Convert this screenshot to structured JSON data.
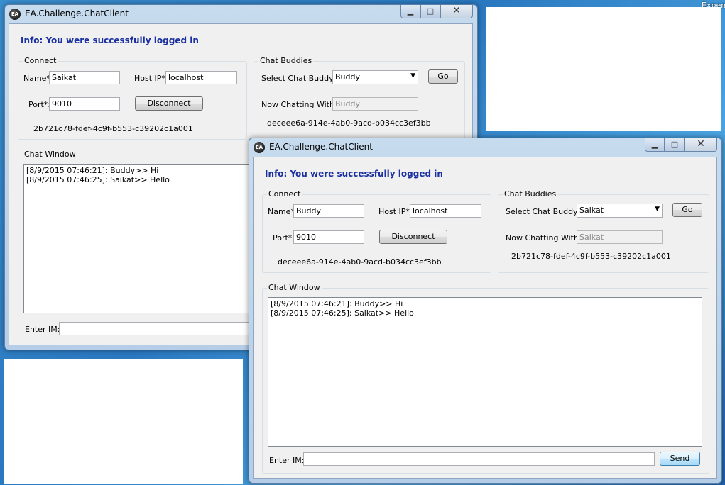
{
  "desktop": {
    "top_right_text": "Expens"
  },
  "window_back": {
    "title": "EA.Challenge.ChatClient",
    "controls": {
      "minimize": "▁",
      "maximize": "□",
      "close": "✕"
    },
    "info": "Info: You were successfully logged in",
    "connect": {
      "group_title": "Connect",
      "name_label": "Name*:",
      "name_value": "Saikat",
      "host_label": "Host IP*:",
      "host_value": "localhost",
      "port_label": "Port*:",
      "port_value": "9010",
      "disconnect_label": "Disconnect",
      "guid": "2b721c78-fdef-4c9f-b553-c39202c1a001"
    },
    "buddies": {
      "group_title": "Chat Buddies",
      "select_label": "Select Chat Buddy:",
      "select_value": "Buddy",
      "go_label": "Go",
      "now_chatting_label": "Now Chatting With:",
      "now_chatting_value": "Buddy",
      "guid": "deceee6a-914e-4ab0-9acd-b034cc3ef3bb"
    },
    "chat": {
      "group_title": "Chat Window",
      "lines": [
        "[8/9/2015 07:46:21]: Buddy>> Hi",
        "[8/9/2015 07:46:25]: Saikat>> Hello"
      ],
      "enter_label": "Enter IM:"
    }
  },
  "window_front": {
    "title": "EA.Challenge.ChatClient",
    "controls": {
      "minimize": "▁",
      "maximize": "□",
      "close": "✕"
    },
    "info": "Info: You were successfully logged in",
    "connect": {
      "group_title": "Connect",
      "name_label": "Name*:",
      "name_value": "Buddy",
      "host_label": "Host IP*:",
      "host_value": "localhost",
      "port_label": "Port*:",
      "port_value": "9010",
      "disconnect_label": "Disconnect",
      "guid": "deceee6a-914e-4ab0-9acd-b034cc3ef3bb"
    },
    "buddies": {
      "group_title": "Chat Buddies",
      "select_label": "Select Chat Buddy:",
      "select_value": "Saikat",
      "go_label": "Go",
      "now_chatting_label": "Now Chatting With:",
      "now_chatting_value": "Saikat",
      "guid": "2b721c78-fdef-4c9f-b553-c39202c1a001"
    },
    "chat": {
      "group_title": "Chat Window",
      "lines": [
        "[8/9/2015 07:46:21]: Buddy>> Hi",
        "[8/9/2015 07:46:25]: Saikat>> Hello"
      ],
      "enter_label": "Enter IM:",
      "send_label": "Send"
    }
  }
}
